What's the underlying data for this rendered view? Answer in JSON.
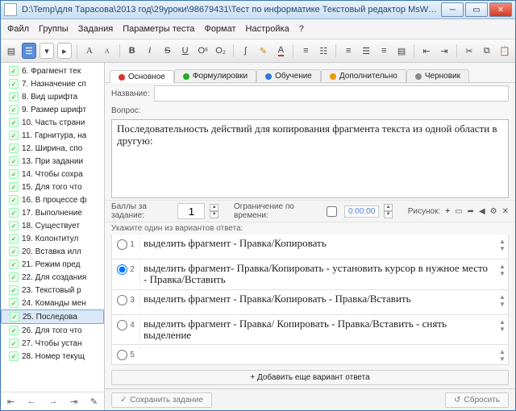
{
  "window": {
    "title": "D:\\Temp\\для Тарасова\\2013 год\\29уроки\\98679431\\Тест по информатике Текстовый редактор MsWord\\Текстовый  редактор Micros..."
  },
  "menu": {
    "file": "Файл",
    "groups": "Группы",
    "tasks": "Задания",
    "params": "Параметры теста",
    "format": "Формат",
    "settings": "Настройка",
    "help": "?"
  },
  "sidebar": {
    "items": [
      {
        "n": "6",
        "t": "Фрагмент тек",
        "c": true
      },
      {
        "n": "7",
        "t": "Назначение сп",
        "c": true
      },
      {
        "n": "8",
        "t": "Вид шрифта",
        "c": true
      },
      {
        "n": "9",
        "t": "Размер шрифт",
        "c": true
      },
      {
        "n": "10",
        "t": "Часть страни",
        "c": true
      },
      {
        "n": "11",
        "t": "Гарнитура, на",
        "c": true
      },
      {
        "n": "12",
        "t": "Ширина, спо",
        "c": true
      },
      {
        "n": "13",
        "t": "При задании",
        "c": true
      },
      {
        "n": "14",
        "t": "Чтобы сохра",
        "c": true
      },
      {
        "n": "15",
        "t": "Для того что",
        "c": true
      },
      {
        "n": "16",
        "t": "В процессе ф",
        "c": true
      },
      {
        "n": "17",
        "t": "Выполнение",
        "c": true
      },
      {
        "n": "18",
        "t": "Существует",
        "c": true
      },
      {
        "n": "19",
        "t": "Колонтитул",
        "c": true
      },
      {
        "n": "20",
        "t": "Вставка илл",
        "c": true
      },
      {
        "n": "21",
        "t": "Режим пред",
        "c": true
      },
      {
        "n": "22",
        "t": "Для создания",
        "c": true
      },
      {
        "n": "23",
        "t": "Текстовый р",
        "c": true
      },
      {
        "n": "24",
        "t": "Команды мен",
        "c": true
      },
      {
        "n": "25",
        "t": "Последова",
        "c": true,
        "sel": true
      },
      {
        "n": "26",
        "t": "Для того что",
        "c": true
      },
      {
        "n": "27",
        "t": "Чтобы устан",
        "c": true
      },
      {
        "n": "28",
        "t": "Номер текущ",
        "c": true
      }
    ]
  },
  "tabs": [
    {
      "label": "Основное",
      "color": "#d33",
      "active": true
    },
    {
      "label": "Формулировки",
      "color": "#2a2"
    },
    {
      "label": "Обучение",
      "color": "#37d"
    },
    {
      "label": "Дополнительно",
      "color": "#e90"
    },
    {
      "label": "Черновик",
      "color": "#888"
    }
  ],
  "form": {
    "name_label": "Название:",
    "question_label": "Вопрос:",
    "question_text": "Последовательность действий для копирования фрагмента текста из одной области в другую:",
    "points_label": "Баллы за задание:",
    "points_value": "1",
    "timelimit_label": "Ограничение по времени:",
    "timelimit_value": "0:00:00",
    "pic_label": "Рисунок:",
    "variants_hint": "Укажите один из вариантов ответа:",
    "add_variant": "+  Добавить еще вариант ответа",
    "save": "Сохранить задание",
    "reset": "Сбросить"
  },
  "answers": [
    {
      "n": "1",
      "text": "выделить фрагмент - Правка/Копировать"
    },
    {
      "n": "2",
      "text": "выделить фрагмент- Правка/Копировать - установить курсор в нужное место - Правка/Вставить",
      "sel": true
    },
    {
      "n": "3",
      "text": "выделить фрагмент - Правка/Копировать - Правка/Вставить"
    },
    {
      "n": "4",
      "text": "выделить фрагмент - Правка/ Копировать - Правка/Вставить - снять выделение"
    },
    {
      "n": "5",
      "text": ""
    }
  ]
}
